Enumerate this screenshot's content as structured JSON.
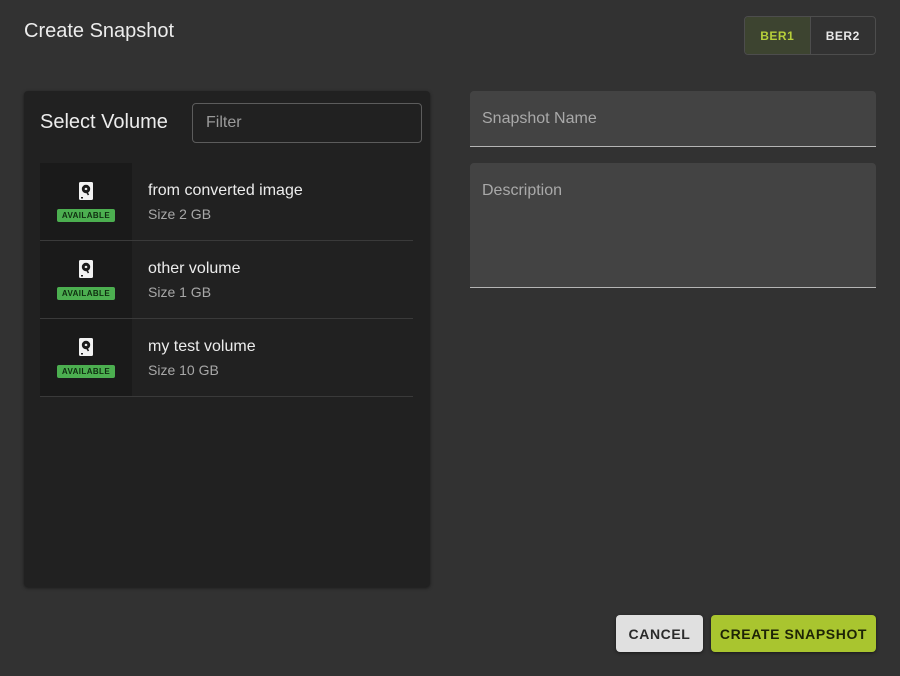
{
  "dialog": {
    "title": "Create Snapshot"
  },
  "regions": [
    {
      "label": "BER1",
      "active": true
    },
    {
      "label": "BER2",
      "active": false
    }
  ],
  "volume_panel": {
    "title": "Select Volume",
    "filter_placeholder": "Filter",
    "volumes": [
      {
        "name": "from converted image",
        "size": "Size 2 GB",
        "status": "AVAILABLE",
        "icon": "hard-drive-icon"
      },
      {
        "name": "other volume",
        "size": "Size 1 GB",
        "status": "AVAILABLE",
        "icon": "hard-drive-icon"
      },
      {
        "name": "my test volume",
        "size": "Size 10 GB",
        "status": "AVAILABLE",
        "icon": "hard-drive-icon"
      }
    ]
  },
  "form": {
    "name_label": "Snapshot Name",
    "description_label": "Description"
  },
  "actions": {
    "cancel_label": "CANCEL",
    "create_label": "CREATE SNAPSHOT"
  },
  "colors": {
    "accent": "#a9c52f",
    "status_available": "#4caf50",
    "background": "#323232",
    "panel": "#212121"
  }
}
